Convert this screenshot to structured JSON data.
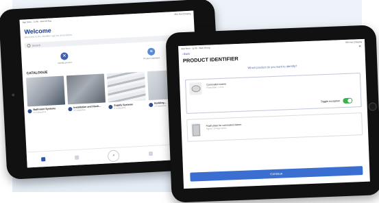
{
  "tablet_back": {
    "status_left": "App Store · 11:45 · Wed 26 Aug",
    "status_right": "78% Not Charging",
    "title": "Welcome",
    "subtitle": "Welcome to the identifier app for all products",
    "search_placeholder": "Search",
    "actions": [
      {
        "label": "Identify product",
        "icon": "x-icon"
      },
      {
        "label": "Product catalogue",
        "icon": "list-icon"
      }
    ],
    "catalogue_title": "CATALOGUE",
    "cards": [
      {
        "title": "Bathroom Systems",
        "subtitle": "12 Categories"
      },
      {
        "title": "Installation and Flush...",
        "subtitle": "8 Categories"
      },
      {
        "title": "Supply Systems",
        "subtitle": "6 Categories"
      },
      {
        "title": "Building...",
        "subtitle": "4 Categories"
      }
    ],
    "nav_fab": "⌕"
  },
  "tablet_front": {
    "status_left": "App Store · 11:45 · Wed 26 Aug",
    "status_right": "78% Not Charging",
    "back": "‹ Back",
    "close": "✕",
    "title": "PRODUCT IDENTIFIER",
    "question": "Which product do you want to identify?",
    "products": [
      {
        "name": "Concealed cistern",
        "desc": "Flush plate · 1.3 m",
        "icon": "toilet-icon"
      },
      {
        "name": "Flush plate for concealed cistern",
        "desc": "Sigma / Omega series",
        "icon": "flush-plate-icon"
      }
    ],
    "toggle_label": "Toggle exception",
    "toggle_on": true,
    "continue_label": "Continue"
  }
}
